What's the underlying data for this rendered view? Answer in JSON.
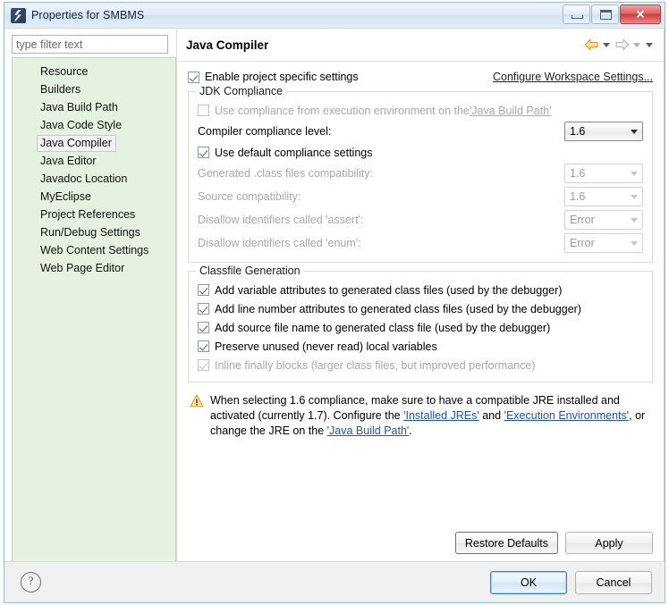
{
  "window": {
    "title": "Properties for SMBMS",
    "icon": "eclipse-icon",
    "buttons": {
      "minimize": "minimize-icon",
      "maximize": "maximize-icon",
      "close": "✕"
    }
  },
  "sidebar": {
    "filter_placeholder": "type filter text",
    "filter_value": "",
    "items": [
      {
        "label": "Resource",
        "selected": false
      },
      {
        "label": "Builders",
        "selected": false
      },
      {
        "label": "Java Build Path",
        "selected": false
      },
      {
        "label": "Java Code Style",
        "selected": false
      },
      {
        "label": "Java Compiler",
        "selected": true
      },
      {
        "label": "Java Editor",
        "selected": false
      },
      {
        "label": "Javadoc Location",
        "selected": false
      },
      {
        "label": "MyEclipse",
        "selected": false
      },
      {
        "label": "Project References",
        "selected": false
      },
      {
        "label": "Run/Debug Settings",
        "selected": false
      },
      {
        "label": "Web Content Settings",
        "selected": false
      },
      {
        "label": "Web Page Editor",
        "selected": false
      }
    ]
  },
  "page": {
    "title": "Java Compiler",
    "enable_project_specific": {
      "label": "Enable project specific settings",
      "checked": true,
      "enabled": true
    },
    "configure_workspace_link": "Configure Workspace Settings...",
    "jdk_compliance": {
      "title": "JDK Compliance",
      "use_execution_env": {
        "label_prefix": "Use compliance from execution environment on the ",
        "label_link": "'Java Build Path'",
        "checked": false,
        "enabled": false
      },
      "compliance_level": {
        "label": "Compiler compliance level:",
        "value": "1.6",
        "enabled": true
      },
      "use_default_settings": {
        "label": "Use default compliance settings",
        "checked": true,
        "enabled": true
      },
      "rows": [
        {
          "label": "Generated .class files compatibility:",
          "value": "1.6",
          "enabled": false
        },
        {
          "label": "Source compatibility:",
          "value": "1.6",
          "enabled": false
        },
        {
          "label": "Disallow identifiers called 'assert':",
          "value": "Error",
          "enabled": false
        },
        {
          "label": "Disallow identifiers called 'enum':",
          "value": "Error",
          "enabled": false
        }
      ]
    },
    "classfile_generation": {
      "title": "Classfile Generation",
      "options": [
        {
          "label": "Add variable attributes to generated class files (used by the debugger)",
          "checked": true,
          "enabled": true
        },
        {
          "label": "Add line number attributes to generated class files (used by the debugger)",
          "checked": true,
          "enabled": true
        },
        {
          "label": "Add source file name to generated class file (used by the debugger)",
          "checked": true,
          "enabled": true
        },
        {
          "label": "Preserve unused (never read) local variables",
          "checked": true,
          "enabled": true
        },
        {
          "label": "Inline finally blocks (larger class files, but improved performance)",
          "checked": true,
          "enabled": false
        }
      ]
    },
    "warning": {
      "icon": "warning-icon",
      "part1": "When selecting 1.6 compliance, make sure to have a compatible JRE installed and activated (currently 1.7). Configure the ",
      "link1": "'Installed JREs'",
      "part2": " and ",
      "link2": "'Execution Environments'",
      "part3": ", or change the JRE on the ",
      "link3": "'Java Build Path'",
      "part4": "."
    },
    "restore_defaults_label": "Restore Defaults",
    "apply_label": "Apply"
  },
  "footer": {
    "help_icon": "?",
    "ok_label": "OK",
    "cancel_label": "Cancel"
  },
  "colors": {
    "accent_blue": "#3c7fb1",
    "sidebar_bg": "#e6f2e1",
    "link_blue": "#2155a5",
    "warning_amber": "#e8a33d",
    "close_red": "#cd3c3a"
  }
}
